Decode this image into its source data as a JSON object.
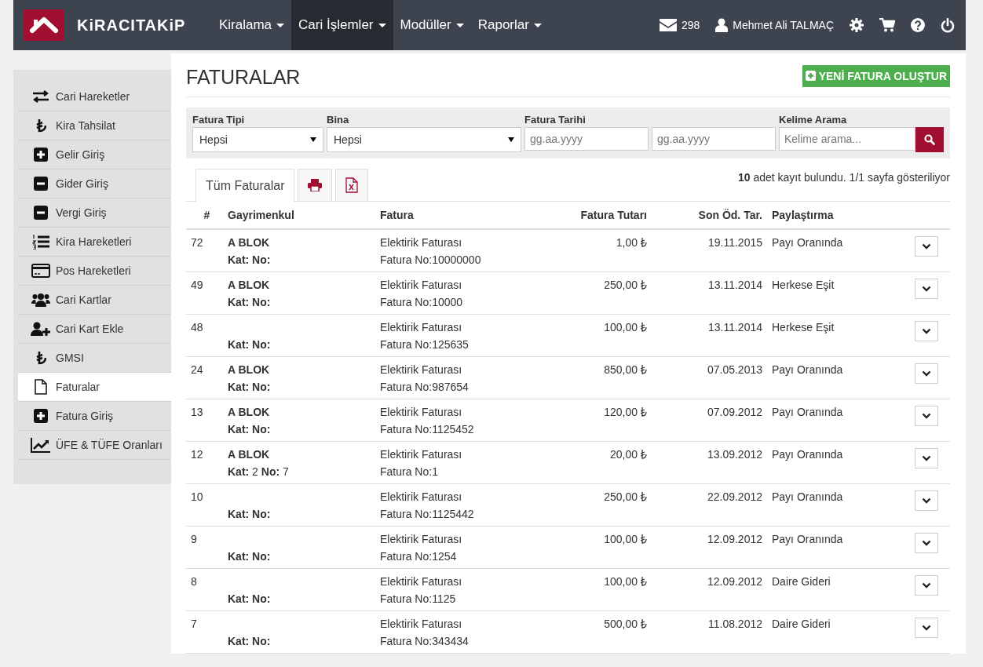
{
  "brand": {
    "name": "KiRACITAKiP"
  },
  "nav": [
    {
      "label": "Kiralama",
      "selected": false
    },
    {
      "label": "Cari İşlemler",
      "selected": true
    },
    {
      "label": "Modüller",
      "selected": false
    },
    {
      "label": "Raporlar",
      "selected": false
    }
  ],
  "user_bar": {
    "messages": "298",
    "user": "Mehmet Ali TALMAÇ"
  },
  "sidebar": {
    "items": [
      {
        "label": "Cari Hareketler",
        "kind": "exchange",
        "selected": false
      },
      {
        "label": "Kira Tahsilat",
        "kind": "lira",
        "selected": false
      },
      {
        "label": "Gelir Giriş",
        "kind": "plus",
        "selected": false
      },
      {
        "label": "Gider Giriş",
        "kind": "minus",
        "selected": false
      },
      {
        "label": "Vergi Giriş",
        "kind": "minus",
        "selected": false
      },
      {
        "label": "Kira Hareketleri",
        "kind": "list",
        "selected": false
      },
      {
        "label": "Pos Hareketleri",
        "kind": "card",
        "selected": false
      },
      {
        "label": "Cari Kartlar",
        "kind": "users",
        "selected": false
      },
      {
        "label": "Cari Kart Ekle",
        "kind": "useradd",
        "selected": false
      },
      {
        "label": "GMSI",
        "kind": "lira",
        "selected": false
      },
      {
        "label": "Faturalar",
        "kind": "file",
        "selected": true
      },
      {
        "label": "Fatura Giriş",
        "kind": "plus",
        "selected": false
      },
      {
        "label": "ÜFE & TÜFE Oranları",
        "kind": "chart",
        "selected": false
      }
    ]
  },
  "page": {
    "title": "FATURALAR",
    "new_button": "YENİ FATURA OLUŞTUR"
  },
  "filters": {
    "type": {
      "label": "Fatura Tipi",
      "value": "Hepsi"
    },
    "building": {
      "label": "Bina",
      "value": "Hepsi"
    },
    "date": {
      "label": "Fatura Tarihi",
      "from_placeholder": "gg.aa.yyyy",
      "to_placeholder": "gg.aa.yyyy"
    },
    "search": {
      "label": "Kelime Arama",
      "placeholder": "Kelime arama..."
    }
  },
  "tabs": [
    {
      "kind": "text",
      "label": "Tüm Faturalar",
      "selected": true
    },
    {
      "kind": "print",
      "selected": false
    },
    {
      "kind": "excel",
      "selected": false
    }
  ],
  "result_info": "**10** adet kayıt bulundu. 1/1 sayfa gösteriliyor",
  "table": {
    "columns": [
      "#",
      "Gayrimenkul",
      "Fatura",
      "Fatura Tutarı",
      "Son Öd. Tar.",
      "Paylaştırma"
    ],
    "rows": [
      {
        "id": "72",
        "building": "A BLOK",
        "unit": "**Kat: No:**",
        "invoice": "Elektirik Faturası",
        "invoice_no": "Fatura No:10000000",
        "amount": "1,00",
        "due": "19.11.2015",
        "share": "Payı Oranında"
      },
      {
        "id": "49",
        "building": "A BLOK",
        "unit": "**Kat: No:**",
        "invoice": "Elektirik Faturası",
        "invoice_no": "Fatura No:10000",
        "amount": "250,00",
        "due": "13.11.2014",
        "share": "Herkese Eşit"
      },
      {
        "id": "48",
        "unit": "**Kat: No:**",
        "invoice": "Elektirik Faturası",
        "invoice_no": "Fatura No:125635",
        "amount": "100,00",
        "due": "13.11.2014",
        "share": "Herkese Eşit"
      },
      {
        "id": "24",
        "building": "A BLOK",
        "unit": "**Kat: No:**",
        "invoice": "Elektirik Faturası",
        "invoice_no": "Fatura No:987654",
        "amount": "850,00",
        "due": "07.05.2013",
        "share": "Payı Oranında"
      },
      {
        "id": "13",
        "building": "A BLOK",
        "unit": "**Kat: No:**",
        "invoice": "Elektirik Faturası",
        "invoice_no": "Fatura No:1125452",
        "amount": "120,00",
        "due": "07.09.2012",
        "share": "Payı Oranında"
      },
      {
        "id": "12",
        "building": "A BLOK",
        "unit": "**Kat:** 2 **No:** 7",
        "invoice": "Elektirik Faturası",
        "invoice_no": "Fatura No:1",
        "amount": "20,00",
        "due": "13.09.2012",
        "share": "Payı Oranında"
      },
      {
        "id": "10",
        "unit": "**Kat: No:**",
        "invoice": "Elektirik Faturası",
        "invoice_no": "Fatura No:1125442",
        "amount": "250,00",
        "due": "22.09.2012",
        "share": "Payı Oranında"
      },
      {
        "id": "9",
        "unit": "**Kat: No:**",
        "invoice": "Elektirik Faturası",
        "invoice_no": "Fatura No:1254",
        "amount": "100,00",
        "due": "12.09.2012",
        "share": "Payı Oranında"
      },
      {
        "id": "8",
        "unit": "**Kat: No:**",
        "invoice": "Elektirik Faturası",
        "invoice_no": "Fatura No:1125",
        "amount": "100,00",
        "due": "12.09.2012",
        "share": "Daire Gideri"
      },
      {
        "id": "7",
        "unit": "**Kat: No:**",
        "invoice": "Elektirik Faturası",
        "invoice_no": "Fatura No:343434",
        "amount": "500,00",
        "due": "11.08.2012",
        "share": "Daire Gideri"
      }
    ]
  }
}
